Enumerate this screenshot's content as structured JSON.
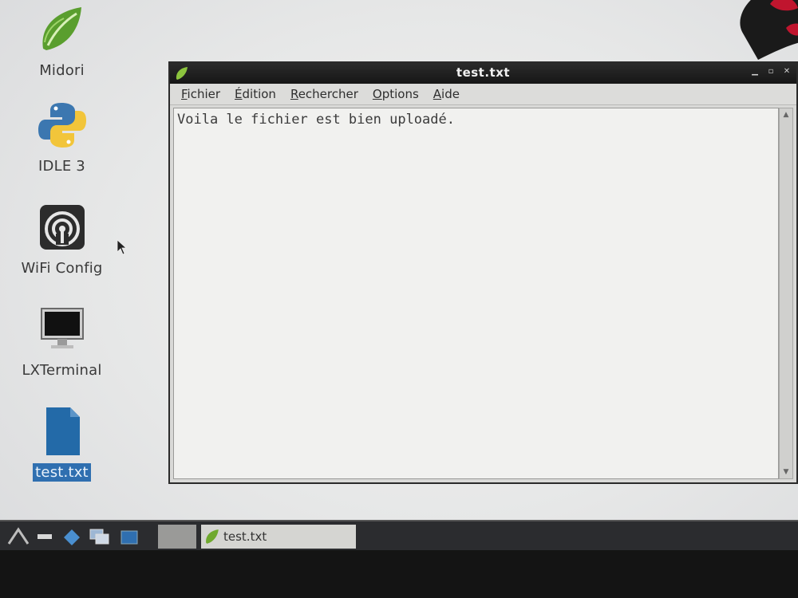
{
  "desktop": {
    "icons": [
      {
        "label": "Midori",
        "icon": "midori-icon"
      },
      {
        "label": "IDLE 3",
        "icon": "python-icon"
      },
      {
        "label": "WiFi Config",
        "icon": "wifi-icon"
      },
      {
        "label": "LXTerminal",
        "icon": "terminal-icon"
      },
      {
        "label": "test.txt",
        "icon": "document-icon",
        "selected": true
      }
    ]
  },
  "window": {
    "title": "test.txt",
    "menu": [
      {
        "mnemonic": "F",
        "rest": "ichier"
      },
      {
        "mnemonic": "É",
        "rest": "dition"
      },
      {
        "mnemonic": "R",
        "rest": "echercher"
      },
      {
        "mnemonic": "O",
        "rest": "ptions"
      },
      {
        "mnemonic": "A",
        "rest": "ide"
      }
    ],
    "content": "Voila le fichier est bien uploadé."
  },
  "taskbar": {
    "task_label": "test.txt"
  },
  "colors": {
    "selection": "#2f6fb0",
    "titlebar": "#1c1c1c",
    "taskbar": "#2b2c2f"
  }
}
